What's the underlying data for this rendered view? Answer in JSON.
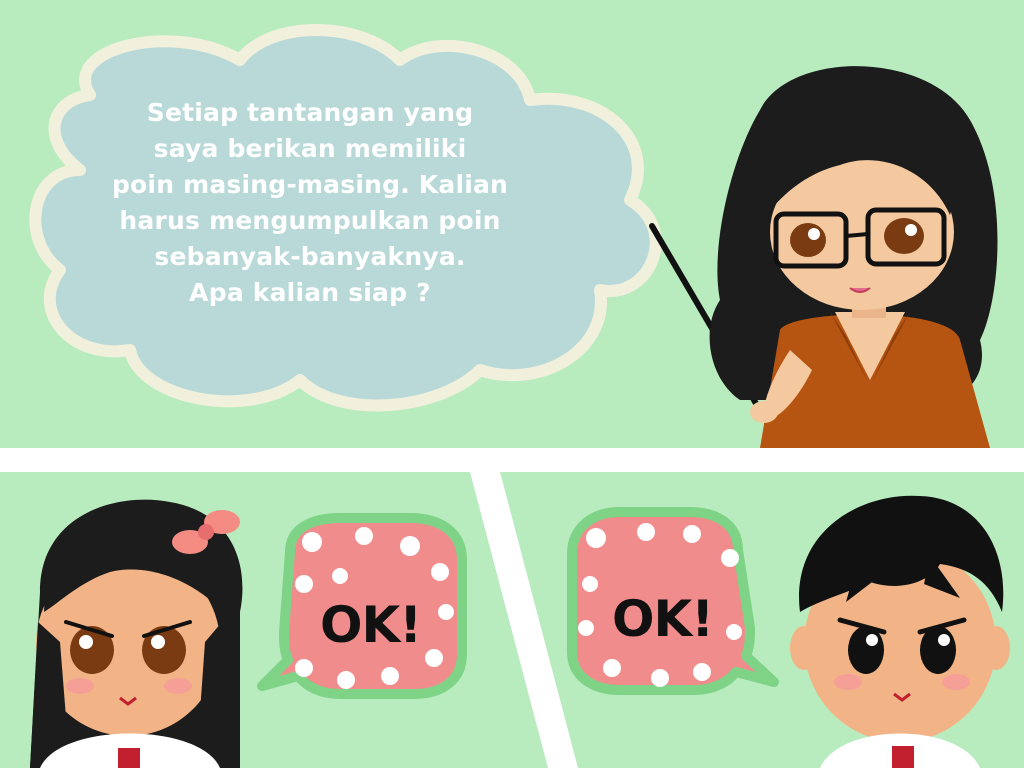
{
  "teacher_panel": {
    "speech_lines": [
      "Setiap tantangan yang",
      "saya berikan memiliki",
      "poin masing-masing. Kalian",
      "harus mengumpulkan poin",
      "sebanyak-banyaknya.",
      "Apa kalian siap ?"
    ]
  },
  "girl_panel": {
    "reply": "OK!"
  },
  "boy_panel": {
    "reply": "OK!"
  },
  "colors": {
    "panel_background": "#b8ecbf",
    "cloud_fill": "#b9d9d9",
    "cloud_border": "#f1f0dc",
    "ok_bubble_fill": "#f08c8c",
    "ok_bubble_border": "#7ed387",
    "blazer": "#b65412",
    "hair": "#1c1c1c",
    "skin": "#f5c9a0"
  }
}
